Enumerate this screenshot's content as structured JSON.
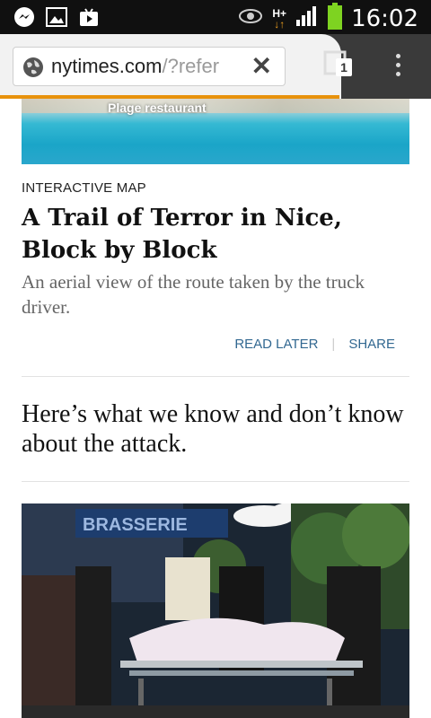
{
  "status_bar": {
    "time": "16:02",
    "network": "H+",
    "icons": [
      "messenger-icon",
      "gallery-icon",
      "play-store-icon",
      "eye-icon",
      "signal-icon",
      "battery-icon"
    ],
    "battery_color": "#7ed321"
  },
  "browser": {
    "url_host": "nytimes.com",
    "url_path": "/?refer",
    "tab_count": "1",
    "accent_color": "#e8920c"
  },
  "hero_image": {
    "caption": "Plage restaurant"
  },
  "article": {
    "kicker": "INTERACTIVE MAP",
    "headline": "A Trail of Terror in Nice, Block by Block",
    "summary": "An aerial view of the route taken by the truck driver.",
    "read_later_label": "READ LATER",
    "separator": "|",
    "share_label": "SHARE"
  },
  "article2": {
    "headline": "Here’s what we know and don’t know about the attack."
  },
  "photo": {
    "sign_text": "BRASSERIE"
  }
}
